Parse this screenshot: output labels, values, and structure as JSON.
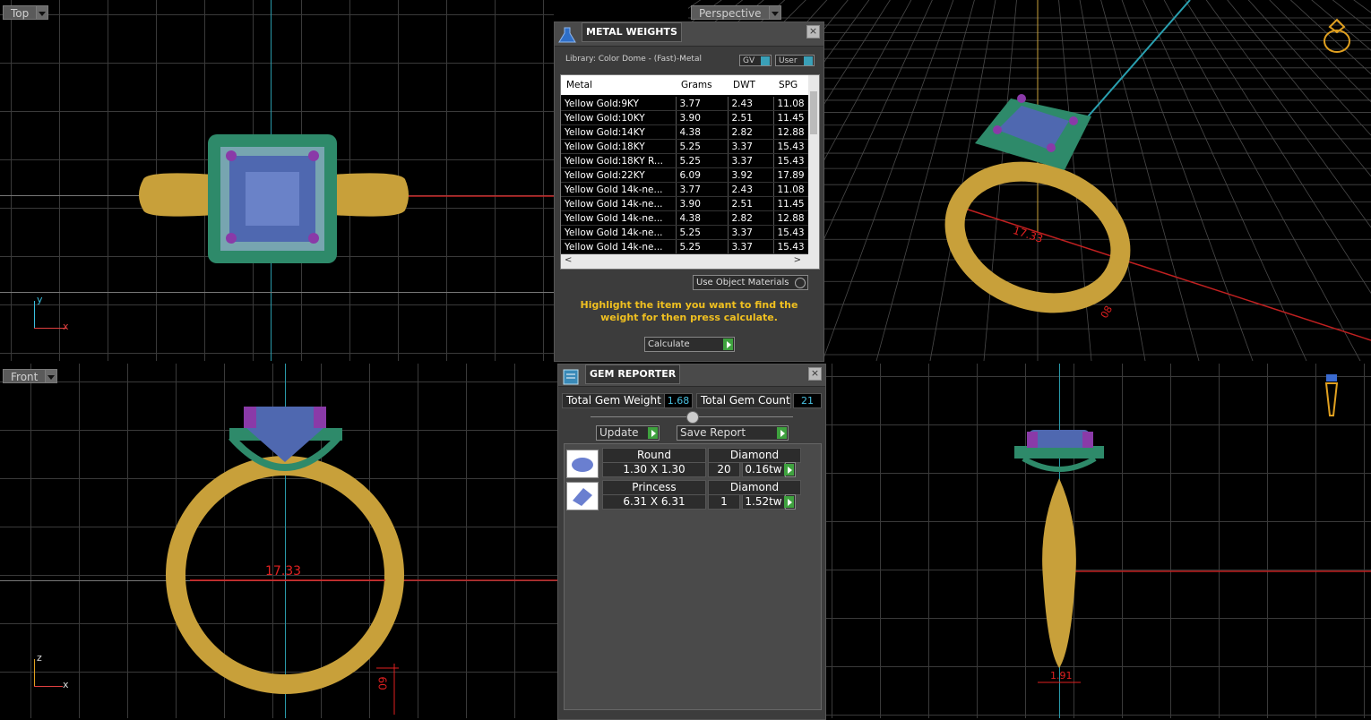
{
  "viewports": {
    "top": {
      "label": "Top"
    },
    "perspective": {
      "label": "Perspective"
    },
    "front": {
      "label": "Front"
    }
  },
  "axes": {
    "top_y": "y",
    "top_x": "x",
    "front_z": "z",
    "front_x": "x"
  },
  "dimensions": {
    "front_ring": "17.33",
    "front_height": "09",
    "perspective_ring": "17.33",
    "perspective_small": "08",
    "side_width": "1.91"
  },
  "metal_weights": {
    "title": "METAL WEIGHTS",
    "library": "Library: Color Dome - (Fast)-Metal",
    "gv_label": "GV",
    "user_label": "User",
    "columns": [
      "Metal",
      "Grams",
      "DWT",
      "SPG"
    ],
    "rows": [
      [
        "Yellow Gold:9KY",
        "3.77",
        "2.43",
        "11.08"
      ],
      [
        "Yellow Gold:10KY",
        "3.90",
        "2.51",
        "11.45"
      ],
      [
        "Yellow Gold:14KY",
        "4.38",
        "2.82",
        "12.88"
      ],
      [
        "Yellow Gold:18KY",
        "5.25",
        "3.37",
        "15.43"
      ],
      [
        "Yellow Gold:18KY R...",
        "5.25",
        "3.37",
        "15.43"
      ],
      [
        "Yellow Gold:22KY",
        "6.09",
        "3.92",
        "17.89"
      ],
      [
        "Yellow Gold 14k-ne...",
        "3.77",
        "2.43",
        "11.08"
      ],
      [
        "Yellow Gold 14k-ne...",
        "3.90",
        "2.51",
        "11.45"
      ],
      [
        "Yellow Gold 14k-ne...",
        "4.38",
        "2.82",
        "12.88"
      ],
      [
        "Yellow Gold 14k-ne...",
        "5.25",
        "3.37",
        "15.43"
      ],
      [
        "Yellow Gold 14k-ne...",
        "5.25",
        "3.37",
        "15.43"
      ]
    ],
    "use_object_materials": "Use Object Materials",
    "instruction": "Highlight the item you want to find the weight for then press calculate.",
    "calculate_label": "Calculate"
  },
  "gem_reporter": {
    "title": "GEM REPORTER",
    "total_weight_label": "Total Gem Weight",
    "total_weight_value": "1.68",
    "total_count_label": "Total Gem Count",
    "total_count_value": "21",
    "update_label": "Update",
    "save_report_label": "Save Report",
    "gems": [
      {
        "shape": "Round",
        "material": "Diamond",
        "size": "1.30 X 1.30",
        "count": "20",
        "weight": "0.16tw"
      },
      {
        "shape": "Princess",
        "material": "Diamond",
        "size": "6.31 X 6.31",
        "count": "1",
        "weight": "1.52tw"
      }
    ]
  },
  "colors": {
    "gold": "#c8a03a",
    "setting_green": "#2e8a6a",
    "stone_blue": "#4f68b0",
    "prong_purple": "#8a3aa8",
    "dim_red": "#e02020",
    "axis_cyan": "#2aa0b0"
  }
}
